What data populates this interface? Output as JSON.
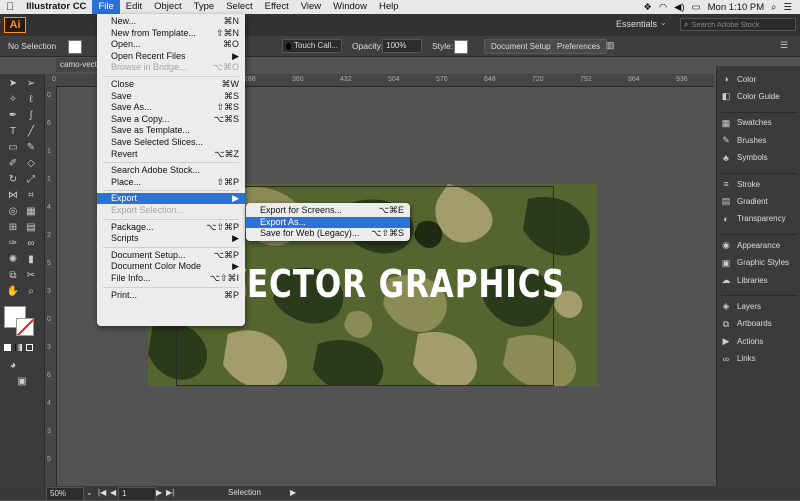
{
  "menubar": {
    "apple": "",
    "app_name": "Illustrator CC",
    "items": [
      "File",
      "Edit",
      "Object",
      "Type",
      "Select",
      "Effect",
      "View",
      "Window",
      "Help"
    ],
    "active": "File",
    "clock": "Mon 1:10 PM"
  },
  "appbar": {
    "logo": "Ai",
    "workspace": "Essentials",
    "search_placeholder": "Search Adobe Stock"
  },
  "controlbar": {
    "selection": "No Selection",
    "brush": "Touch Call...",
    "opacity_label": "Opacity:",
    "opacity_value": "100%",
    "style_label": "Style:",
    "document_setup": "Document Setup",
    "preferences": "Preferences"
  },
  "doc_tab": "camo-vecto",
  "rulers": {
    "top": [
      "0",
      "72",
      "144",
      "216",
      "288",
      "360",
      "432",
      "504",
      "576",
      "648",
      "720",
      "792",
      "864",
      "936"
    ],
    "left": [
      "0",
      "6",
      "1",
      "1",
      "4",
      "2",
      "5",
      "3",
      "0",
      "3",
      "6",
      "4",
      "3",
      "5"
    ]
  },
  "artboard": {
    "headline": "VECTOR GRAPHICS"
  },
  "file_menu": [
    {
      "label": "New...",
      "shortcut": "⌘N"
    },
    {
      "label": "New from Template...",
      "shortcut": "⇧⌘N"
    },
    {
      "label": "Open...",
      "shortcut": "⌘O"
    },
    {
      "label": "Open Recent Files",
      "shortcut": "▶"
    },
    {
      "label": "Browse in Bridge...",
      "shortcut": "⌥⌘O",
      "disabled": true
    },
    {
      "sep": true
    },
    {
      "label": "Close",
      "shortcut": "⌘W"
    },
    {
      "label": "Save",
      "shortcut": "⌘S"
    },
    {
      "label": "Save As...",
      "shortcut": "⇧⌘S"
    },
    {
      "label": "Save a Copy...",
      "shortcut": "⌥⌘S"
    },
    {
      "label": "Save as Template...",
      "shortcut": ""
    },
    {
      "label": "Save Selected Slices...",
      "shortcut": ""
    },
    {
      "label": "Revert",
      "shortcut": "⌥⌘Z"
    },
    {
      "sep": true
    },
    {
      "label": "Search Adobe Stock...",
      "shortcut": ""
    },
    {
      "label": "Place...",
      "shortcut": "⇧⌘P"
    },
    {
      "sep": true
    },
    {
      "label": "Export",
      "shortcut": "▶",
      "highlight": true
    },
    {
      "label": "Export Selection...",
      "shortcut": "",
      "disabled": true
    },
    {
      "sep": true
    },
    {
      "label": "Package...",
      "shortcut": "⌥⇧⌘P"
    },
    {
      "label": "Scripts",
      "shortcut": "▶"
    },
    {
      "sep": true
    },
    {
      "label": "Document Setup...",
      "shortcut": "⌥⌘P"
    },
    {
      "label": "Document Color Mode",
      "shortcut": "▶"
    },
    {
      "label": "File Info...",
      "shortcut": "⌥⇧⌘I"
    },
    {
      "sep": true
    },
    {
      "label": "Print...",
      "shortcut": "⌘P"
    }
  ],
  "export_submenu": [
    {
      "label": "Export for Screens...",
      "shortcut": "⌥⌘E"
    },
    {
      "label": "Export As...",
      "shortcut": "",
      "highlight": true
    },
    {
      "label": "Save for Web (Legacy)...",
      "shortcut": "⌥⇧⌘S"
    }
  ],
  "panels": [
    {
      "label": "Color",
      "icon": "color-icon",
      "glyph": "◑"
    },
    {
      "label": "Color Guide",
      "icon": "color-guide-icon",
      "glyph": "◧"
    },
    {
      "sep": true
    },
    {
      "label": "Swatches",
      "icon": "swatches-icon",
      "glyph": "▦"
    },
    {
      "label": "Brushes",
      "icon": "brushes-icon",
      "glyph": "✎"
    },
    {
      "label": "Symbols",
      "icon": "symbols-icon",
      "glyph": "♣"
    },
    {
      "sep": true
    },
    {
      "label": "Stroke",
      "icon": "stroke-icon",
      "glyph": "≡"
    },
    {
      "label": "Gradient",
      "icon": "gradient-icon",
      "glyph": "▤"
    },
    {
      "label": "Transparency",
      "icon": "transparency-icon",
      "glyph": "◐"
    },
    {
      "sep": true
    },
    {
      "label": "Appearance",
      "icon": "appearance-icon",
      "glyph": "◉"
    },
    {
      "label": "Graphic Styles",
      "icon": "graphic-styles-icon",
      "glyph": "▣"
    },
    {
      "label": "Libraries",
      "icon": "libraries-icon",
      "glyph": "☁"
    },
    {
      "sep": true
    },
    {
      "label": "Layers",
      "icon": "layers-icon",
      "glyph": "◈"
    },
    {
      "label": "Artboards",
      "icon": "artboards-icon",
      "glyph": "⧉"
    },
    {
      "label": "Actions",
      "icon": "actions-icon",
      "glyph": "▶"
    },
    {
      "label": "Links",
      "icon": "links-icon",
      "glyph": "∞"
    }
  ],
  "statusbar": {
    "zoom": "50%",
    "artboard_num": "1",
    "status": "Selection"
  }
}
